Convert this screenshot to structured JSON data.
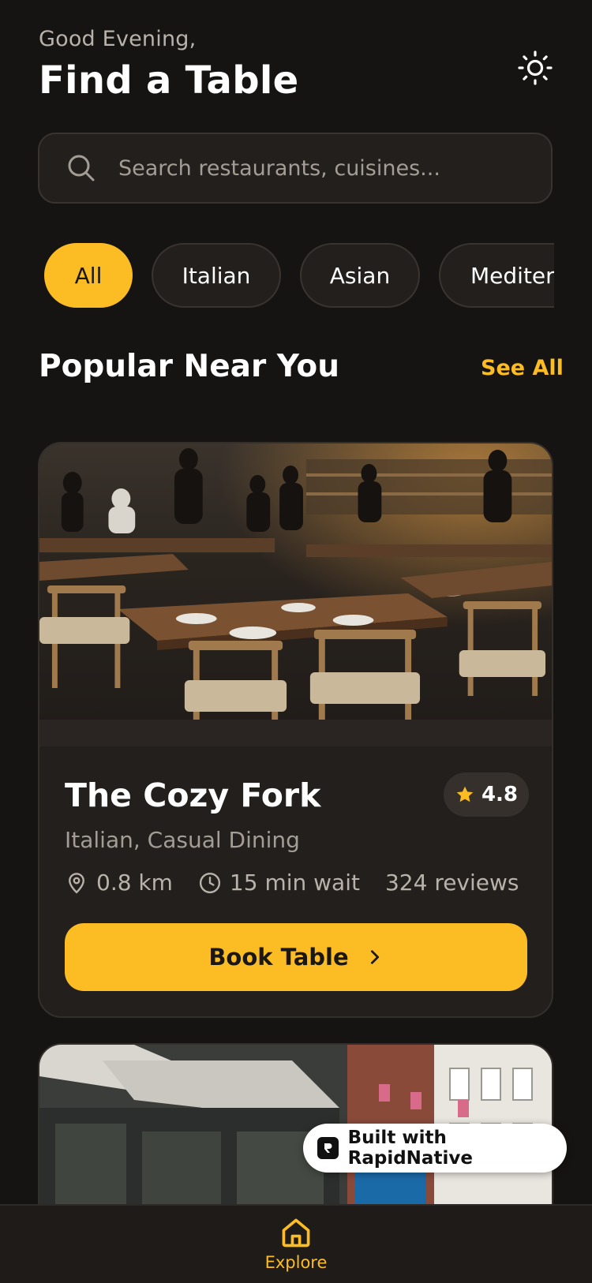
{
  "header": {
    "greeting": "Good Evening,",
    "title": "Find a Table",
    "theme_icon": "sun-icon"
  },
  "search": {
    "placeholder": "Search restaurants, cuisines...",
    "icon": "search-icon"
  },
  "categories": {
    "items": [
      "All",
      "Italian",
      "Asian",
      "Mediterranean"
    ],
    "selected": "All"
  },
  "section": {
    "title": "Popular Near You",
    "see_all": "See All"
  },
  "restaurant": {
    "name": "The Cozy Fork",
    "rating": "4.8",
    "cuisine": "Italian, Casual Dining",
    "distance": "0.8 km",
    "wait": "15 min wait",
    "reviews": "324 reviews",
    "book_label": "Book Table"
  },
  "badge": {
    "label": "Built with RapidNative"
  },
  "tabbar": {
    "explore_label": "Explore"
  },
  "colors": {
    "accent": "#fbbd23",
    "background": "#161412",
    "surface": "#221f1c"
  }
}
